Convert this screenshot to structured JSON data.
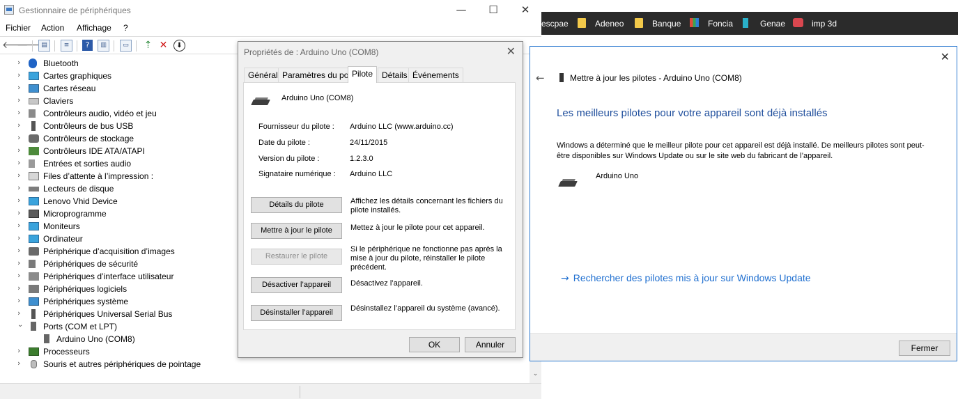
{
  "device_manager": {
    "title": "Gestionnaire de périphériques",
    "window_controls": {
      "minimize": "—",
      "maximize": "☐",
      "close": "✕"
    },
    "menu": [
      "Fichier",
      "Action",
      "Affichage",
      "?"
    ],
    "tree": [
      {
        "label": "Bluetooth",
        "icon": "bluetooth-icon",
        "expanded": false
      },
      {
        "label": "Cartes graphiques",
        "icon": "display-adapter-icon",
        "expanded": false
      },
      {
        "label": "Cartes réseau",
        "icon": "network-adapter-icon",
        "expanded": false
      },
      {
        "label": "Claviers",
        "icon": "keyboard-icon",
        "expanded": false
      },
      {
        "label": "Contrôleurs audio, vidéo et jeu",
        "icon": "audio-icon",
        "expanded": false
      },
      {
        "label": "Contrôleurs de bus USB",
        "icon": "usb-icon",
        "expanded": false
      },
      {
        "label": "Contrôleurs de stockage",
        "icon": "storage-icon",
        "expanded": false
      },
      {
        "label": "Contrôleurs IDE ATA/ATAPI",
        "icon": "ide-icon",
        "expanded": false
      },
      {
        "label": "Entrées et sorties audio",
        "icon": "speaker-icon",
        "expanded": false
      },
      {
        "label": "Files d’attente à l’impression :",
        "icon": "printer-icon",
        "expanded": false
      },
      {
        "label": "Lecteurs de disque",
        "icon": "disk-icon",
        "expanded": false
      },
      {
        "label": "Lenovo Vhid Device",
        "icon": "monitor-icon",
        "expanded": false
      },
      {
        "label": "Microprogramme",
        "icon": "firmware-icon",
        "expanded": false
      },
      {
        "label": "Moniteurs",
        "icon": "monitor-icon",
        "expanded": false
      },
      {
        "label": "Ordinateur",
        "icon": "computer-icon",
        "expanded": false
      },
      {
        "label": "Périphérique d’acquisition d’images",
        "icon": "camera-icon",
        "expanded": false
      },
      {
        "label": "Périphériques de sécurité",
        "icon": "security-icon",
        "expanded": false
      },
      {
        "label": "Périphériques d’interface utilisateur",
        "icon": "hid-icon",
        "expanded": false
      },
      {
        "label": "Périphériques logiciels",
        "icon": "software-device-icon",
        "expanded": false
      },
      {
        "label": "Périphériques système",
        "icon": "system-device-icon",
        "expanded": false
      },
      {
        "label": "Périphériques Universal Serial Bus",
        "icon": "usb-icon",
        "expanded": false
      },
      {
        "label": "Ports (COM et LPT)",
        "icon": "port-icon",
        "expanded": true
      },
      {
        "label": "Arduino Uno (COM8)",
        "icon": "port-icon",
        "child": true
      },
      {
        "label": "Processeurs",
        "icon": "processor-icon",
        "expanded": false
      },
      {
        "label": "Souris et autres périphériques de pointage",
        "icon": "mouse-icon",
        "expanded": false
      }
    ]
  },
  "bookmarks": [
    {
      "label": "escpae",
      "icon": "none"
    },
    {
      "label": "Adeneo",
      "icon": "folder-icon"
    },
    {
      "label": "Banque",
      "icon": "folder-icon"
    },
    {
      "label": "Foncia",
      "icon": "grid-icon"
    },
    {
      "label": "Genae",
      "icon": "dna-icon"
    },
    {
      "label": "imp 3d",
      "icon": "cube-icon"
    }
  ],
  "properties_dialog": {
    "title": "Propriétés de : Arduino Uno (COM8)",
    "tabs": [
      "Général",
      "Paramètres du port",
      "Pilote",
      "Détails",
      "Événements"
    ],
    "active_tab": "Pilote",
    "device_name": "Arduino Uno (COM8)",
    "info": [
      {
        "label": "Fournisseur du pilote :",
        "value": "Arduino LLC (www.arduino.cc)"
      },
      {
        "label": "Date du pilote :",
        "value": "24/11/2015"
      },
      {
        "label": "Version du pilote :",
        "value": "1.2.3.0"
      },
      {
        "label": "Signataire numérique :",
        "value": "Arduino LLC"
      }
    ],
    "actions": [
      {
        "button": "Détails du pilote",
        "description": "Affichez les détails concernant les fichiers du pilote installés.",
        "enabled": true
      },
      {
        "button": "Mettre à jour le pilote",
        "description": "Mettez à jour le pilote pour cet appareil.",
        "enabled": true
      },
      {
        "button": "Restaurer le pilote",
        "description": "Si le périphérique ne fonctionne pas après la mise à jour du pilote, réinstaller le pilote précédent.",
        "enabled": false
      },
      {
        "button": "Désactiver l’appareil",
        "description": "Désactivez l’appareil.",
        "enabled": true
      },
      {
        "button": "Désinstaller l’appareil",
        "description": "Désinstallez l’appareil du système (avancé).",
        "enabled": true
      }
    ],
    "ok": "OK",
    "cancel": "Annuler"
  },
  "update_dialog": {
    "header": "Mettre à jour les pilotes - Arduino Uno (COM8)",
    "heading": "Les meilleurs pilotes pour votre appareil sont déjà installés",
    "description": "Windows a déterminé que le meilleur pilote pour cet appareil est déjà installé. De meilleurs pilotes sont peut-être disponibles sur Windows Update ou sur le site web du fabricant de l’appareil.",
    "device": "Arduino Uno",
    "link": "Rechercher des pilotes mis à jour sur Windows Update",
    "close_button": "Fermer"
  }
}
